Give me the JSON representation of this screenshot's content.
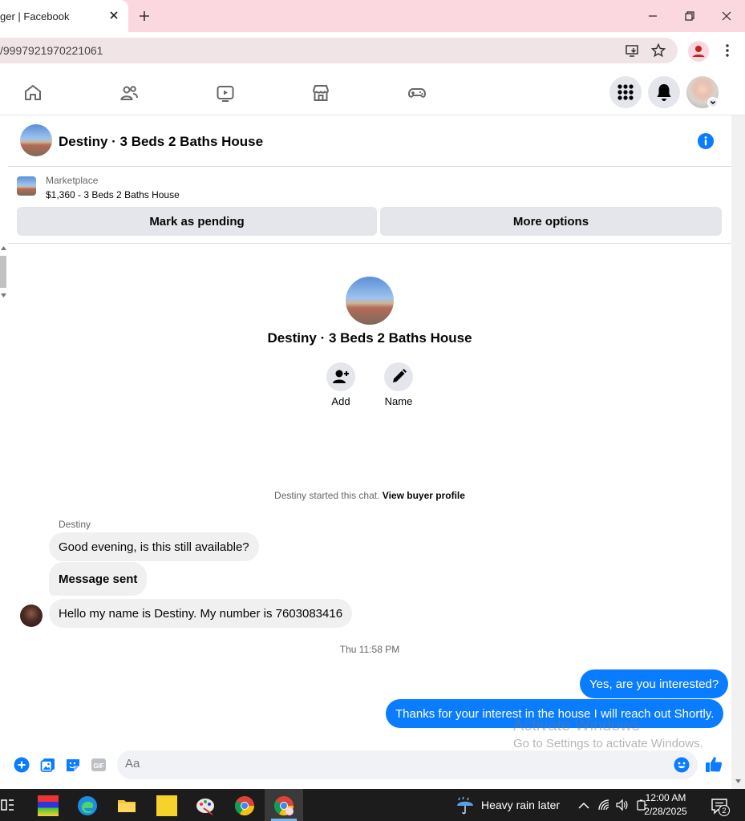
{
  "browser": {
    "tab_title": "ger | Facebook",
    "url": "/9997921970221061"
  },
  "chat": {
    "title": "Destiny · 3 Beds 2 Baths House"
  },
  "listing": {
    "source": "Marketplace",
    "summary": "$1,360 - 3 Beds 2 Baths House",
    "mark_pending_label": "Mark as pending",
    "more_options_label": "More options"
  },
  "profile": {
    "name": "Destiny · 3 Beds 2 Baths House",
    "add_label": "Add",
    "name_label": "Name"
  },
  "thread": {
    "started_text": "Destiny started this chat.",
    "view_profile_label": "View buyer profile",
    "sender": "Destiny",
    "incoming": [
      "Good evening, is this still available?",
      "Message sent",
      "Hello my name is Destiny. My number is 7603083416"
    ],
    "timestamp": "Thu 11:58 PM",
    "outgoing": [
      "Yes, are you interested?",
      "Thanks for your interest in the house I will reach out Shortly."
    ]
  },
  "watermark": {
    "line1": "Activate Windows",
    "line2": "Go to Settings to activate Windows."
  },
  "composer": {
    "placeholder": "Aa"
  },
  "taskbar": {
    "weather": "Heavy rain later",
    "time": "12:00 AM",
    "date": "2/28/2025",
    "notification_count": "2"
  },
  "colors": {
    "accent": "#0a7cff",
    "tabstrip": "#fbd7df",
    "bubble_in": "#f0f0f0"
  }
}
